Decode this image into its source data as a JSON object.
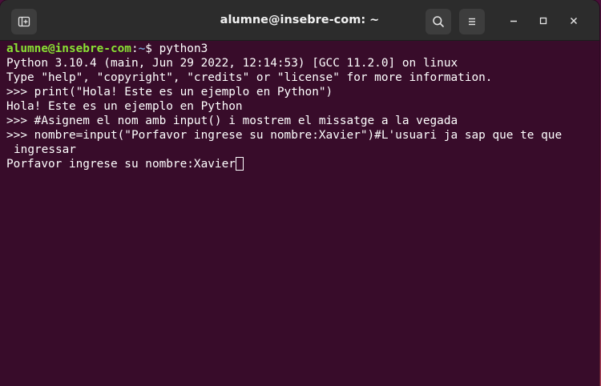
{
  "window": {
    "title": "alumne@insebre-com: ~"
  },
  "icons": {
    "new_tab": "new-tab-icon",
    "search": "search-icon",
    "menu": "hamburger-menu-icon",
    "minimize": "minimize-icon",
    "maximize": "maximize-icon",
    "close": "close-icon"
  },
  "colors": {
    "terminal_bg": "#380c2a",
    "prompt_user": "#8ae234",
    "prompt_path": "#729fcf",
    "text": "#ffffff",
    "titlebar": "#2c2c2c"
  },
  "terminal": {
    "prompt_user_host": "alumne@insebre-com",
    "prompt_colon": ":",
    "prompt_path": "~",
    "prompt_symbol": "$ ",
    "command": "python3",
    "lines": [
      "Python 3.10.4 (main, Jun 29 2022, 12:14:53) [GCC 11.2.0] on linux",
      "Type \"help\", \"copyright\", \"credits\" or \"license\" for more information.",
      ">>> print(\"Hola! Este es un ejemplo en Python\")",
      "Hola! Este es un ejemplo en Python",
      ">>> #Asignem el nom amb input() i mostrem el missatge a la vegada",
      ">>> nombre=input(\"Porfavor ingrese su nombre:Xavier\")#L'usuari ja sap que te que",
      "ingressar",
      "Porfavor ingrese su nombre:Xavier"
    ]
  }
}
